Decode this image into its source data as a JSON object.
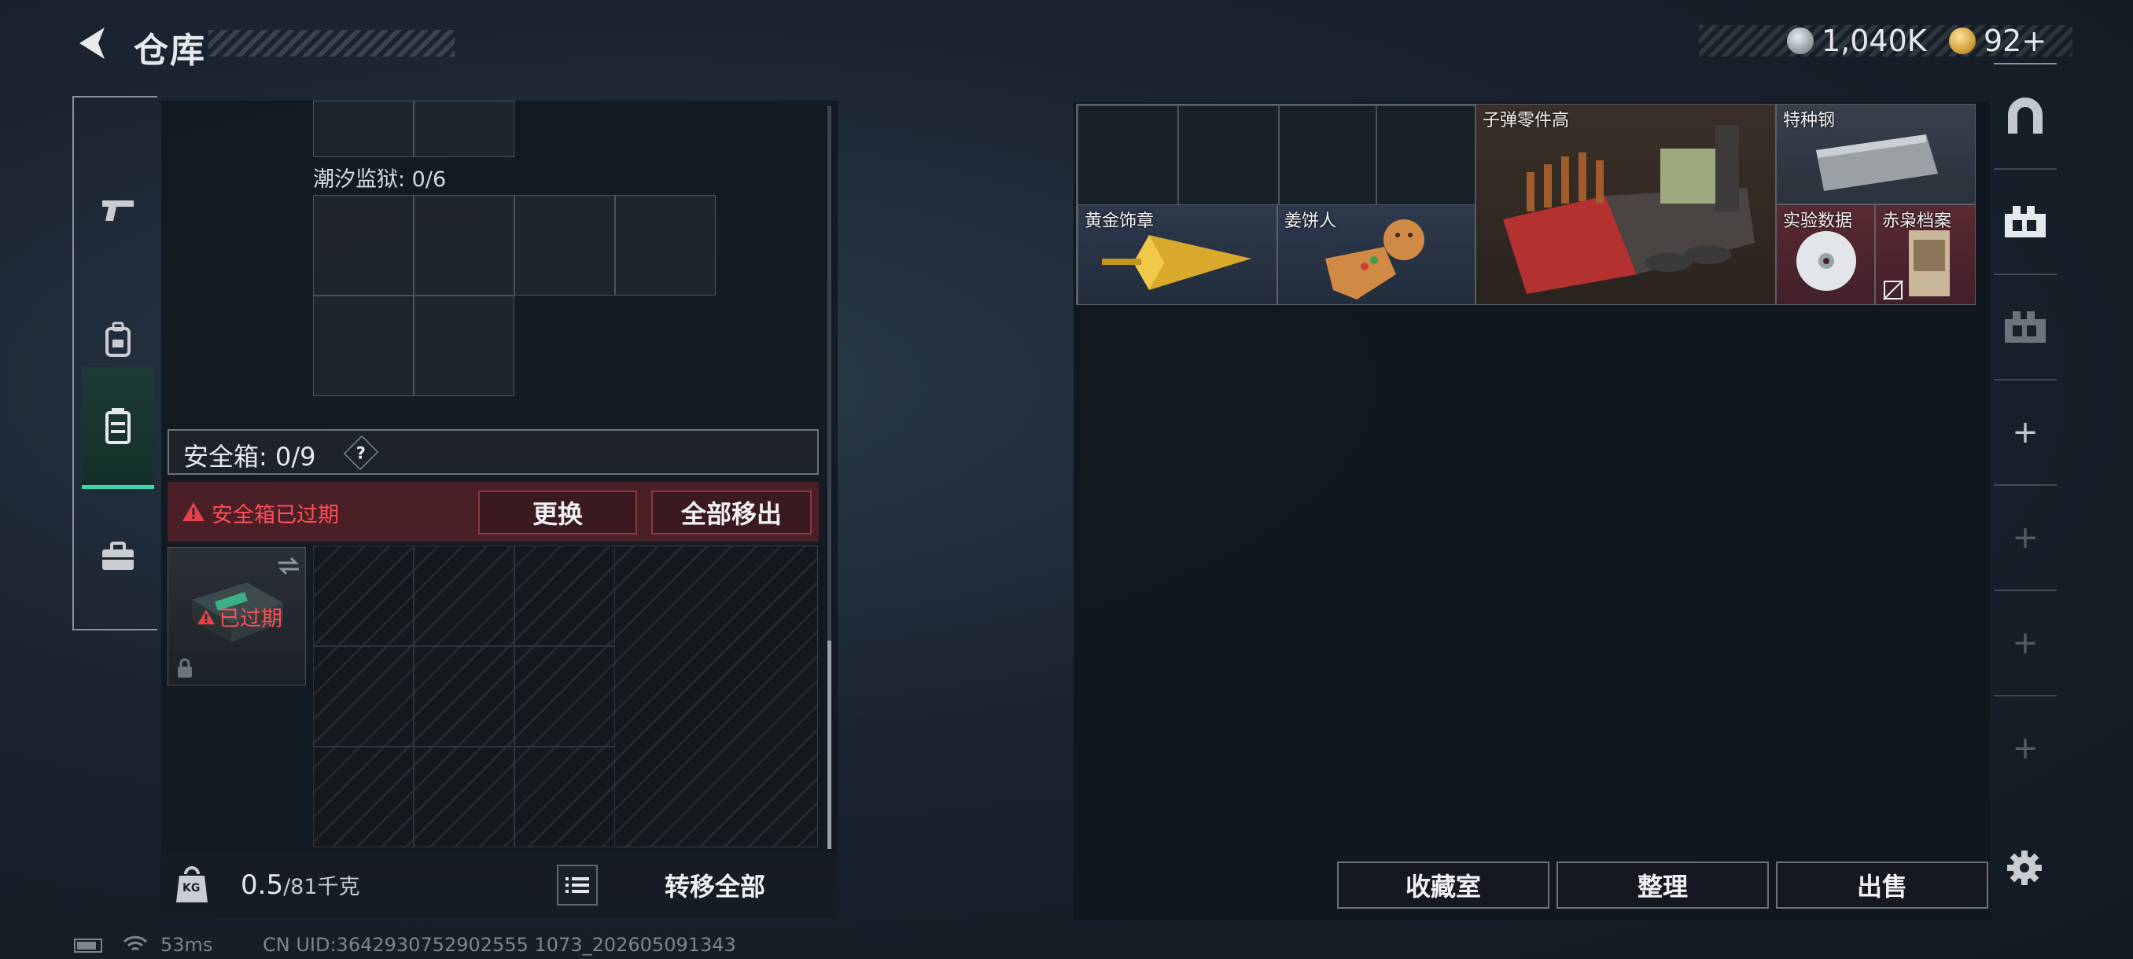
{
  "header": {
    "title": "仓库"
  },
  "currency": {
    "silver": "1,040K",
    "gold": "92+"
  },
  "sidebar": {
    "items": [
      {
        "name": "weapons",
        "icon": "gun-icon"
      },
      {
        "name": "gear",
        "icon": "backpack-icon"
      },
      {
        "name": "storage",
        "icon": "container-icon",
        "active": true
      },
      {
        "name": "supplies",
        "icon": "toolbox-icon"
      }
    ]
  },
  "left": {
    "prison_label": "潮汐监狱: 0/6",
    "safebox_label": "安全箱: 0/9",
    "help": "?",
    "warning": "安全箱已过期",
    "replace_btn": "更换",
    "remove_all_btn": "全部移出",
    "expired": "已过期",
    "weight_value": "0.5",
    "weight_capacity": "/81千克",
    "weight_badge": "KG",
    "transfer_all_btn": "转移全部"
  },
  "stash": {
    "items": [
      {
        "name": "子弹零件高"
      },
      {
        "name": "特种钢"
      },
      {
        "name": "黄金饰章"
      },
      {
        "name": "姜饼人"
      },
      {
        "name": "实验数据"
      },
      {
        "name": "赤枭档案"
      }
    ]
  },
  "actions": {
    "collection": "收藏室",
    "sort": "整理",
    "sell": "出售"
  },
  "status": {
    "ping": "53ms",
    "uid": "CN UID:3642930752902555 1073_202605091343"
  },
  "colors": {
    "accent": "#3fd4ae",
    "warning": "#e5414b",
    "bg": "#121920"
  }
}
